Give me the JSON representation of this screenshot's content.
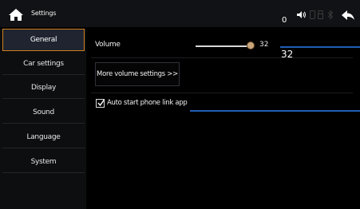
{
  "header": {
    "title": "Settings",
    "status_zero": "0",
    "icons": [
      "home-icon",
      "speaker-icon",
      "phone-icon",
      "usb-icon",
      "bluetooth-icon",
      "back-arrow-icon"
    ]
  },
  "sidebar": {
    "items": [
      {
        "label": "General",
        "active": true
      },
      {
        "label": "Car settings",
        "active": false
      },
      {
        "label": "Display",
        "active": false
      },
      {
        "label": "Sound",
        "active": false
      },
      {
        "label": "Language",
        "active": false
      },
      {
        "label": "System",
        "active": false
      }
    ]
  },
  "main": {
    "volume": {
      "label": "Volume",
      "value": "32",
      "overlay_value": "32"
    },
    "more_volume_button": "More volume settings >>",
    "auto_start": {
      "label": "Auto start phone link app",
      "checked": true
    }
  },
  "colors": {
    "accent_border": "#d07f1c",
    "active_bg": "#1f2430",
    "overlay_line": "#1f5fb5",
    "slider_thumb": "#c9a57a"
  }
}
